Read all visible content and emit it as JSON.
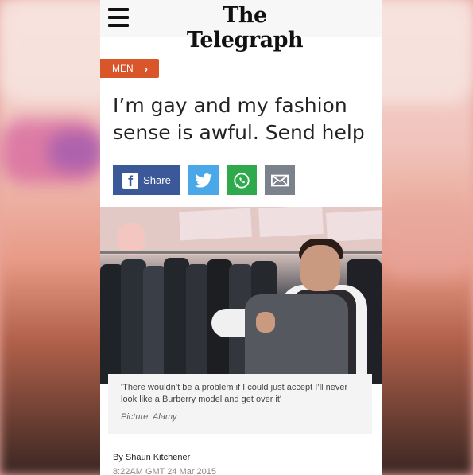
{
  "header": {
    "masthead": "The Telegraph"
  },
  "section": {
    "label": "MEN",
    "chevron": "›"
  },
  "article": {
    "headline": "I’m gay and my fashion sense is awful. Send help",
    "caption": "'There wouldn’t be a problem if I could just accept I’ll never look like a Burberry model and get over it'",
    "credit": "Picture: Alamy",
    "byline": "By Shaun Kitchener",
    "date": "8:22AM GMT 24 Mar 2015"
  },
  "share": {
    "facebook_label": "Share",
    "icons": [
      "facebook-icon",
      "twitter-icon",
      "whatsapp-icon",
      "email-icon"
    ]
  },
  "colors": {
    "section_tag": "#d9562b",
    "facebook": "#3b5998",
    "twitter": "#4aa8e8",
    "whatsapp": "#2ea94c",
    "email": "#7b828b"
  }
}
